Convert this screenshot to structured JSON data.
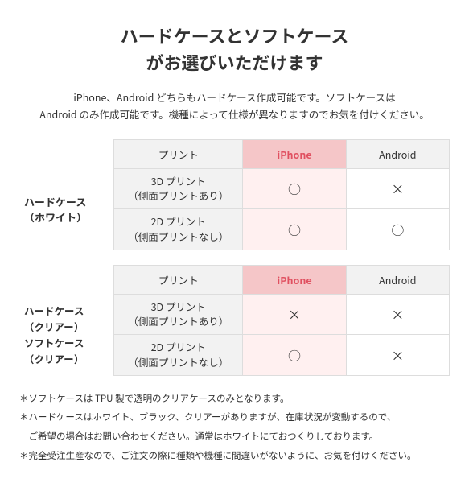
{
  "title": {
    "line1": "ハードケースとソフトケース",
    "line2": "がお選びいただけます"
  },
  "subtitle": "iPhone、Android どちらもハードケース作成可能です。ソフトケースは\nAndroid のみ作成可能です。機種によって仕様が異なりますのでお気を付けください。",
  "table1": {
    "section_label_line1": "ハードケース",
    "section_label_line2": "（ホワイト）",
    "col_print": "プリント",
    "col_iphone": "iPhone",
    "col_android": "Android",
    "rows": [
      {
        "label_line1": "3D プリント",
        "label_line2": "（側面プリントあり）",
        "iphone": "○",
        "android": "×"
      },
      {
        "label_line1": "2D プリント",
        "label_line2": "（側面プリントなし）",
        "iphone": "○",
        "android": "○"
      }
    ]
  },
  "table2": {
    "section_label_line1_1": "ハードケース",
    "section_label_line1_2": "（クリアー）",
    "section_label_line2_1": "ソフトケース",
    "section_label_line2_2": "（クリアー）",
    "col_print": "プリント",
    "col_iphone": "iPhone",
    "col_android": "Android",
    "rows": [
      {
        "label_line1": "3D プリント",
        "label_line2": "（側面プリントあり）",
        "iphone": "×",
        "android": "×"
      },
      {
        "label_line1": "2D プリント",
        "label_line2": "（側面プリントなし）",
        "iphone": "○",
        "android": "×"
      }
    ]
  },
  "notes": [
    "＊ソフトケースは TPU 製で透明のクリアケースのみとなります。",
    "＊ハードケースはホワイト、ブラック、クリアーがありますが、在庫状況が変動するので、",
    "　ご希望の場合はお問い合わせください。通常はホワイトにておつくりしております。",
    "＊完全受注生産なので、ご注文の際に種類や機種に間違いがないように、お気を付けください。"
  ]
}
